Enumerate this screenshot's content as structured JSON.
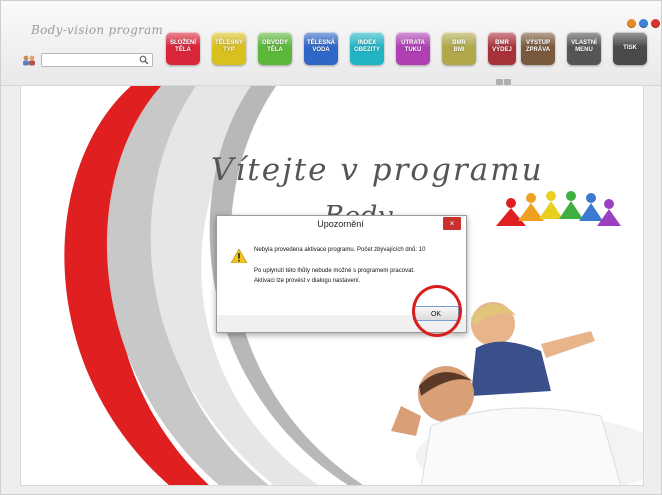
{
  "app": {
    "brand": "Body-vision program"
  },
  "search": {
    "placeholder": ""
  },
  "toolbar": {
    "buttons": [
      {
        "label": "SLOŽENÍ\nTĚLA",
        "color": "#d9263a",
        "icon": "body-composition-icon"
      },
      {
        "label": "TĚLESNÝ\nTYP",
        "color": "#d8c01e",
        "icon": "body-type-icon"
      },
      {
        "label": "OBVODY\nTĚLA",
        "color": "#5cb83a",
        "icon": "body-circumference-icon"
      },
      {
        "label": "TĚLESNÁ\nVODA",
        "color": "#2f67c8",
        "icon": "body-water-icon"
      },
      {
        "label": "INDEX\nOBEZITY",
        "color": "#21b5c4",
        "icon": "obesity-index-icon"
      },
      {
        "label": "ÚTRATA\nTUKU",
        "color": "#b03fb4",
        "icon": "fat-burn-icon"
      },
      {
        "label": "BMR\nBMI",
        "color": "#b0a84a",
        "icon": "bmr-bmi-icon"
      },
      {
        "label": "BMR\nVÝDEJ",
        "color": "#a8323a",
        "icon": "bmr-expense-icon"
      },
      {
        "label": "VÝSTUP\nZPRÁVA",
        "color": "#7a5a3c",
        "icon": "report-icon"
      },
      {
        "label": "VLASTNÍ\nMENU",
        "color": "#555555",
        "icon": "custom-menu-icon"
      },
      {
        "label": "TISK",
        "color": "#4a4a4a",
        "icon": "print-icon"
      }
    ]
  },
  "welcome": {
    "line1": "Vítejte v programu",
    "line2": "Body"
  },
  "dialog": {
    "title": "Upozornění",
    "close": "×",
    "line1": "Nebyla provedena aktivace programu. Počet zbývajících dnů: 10",
    "line2": "Po uplynutí této lhůty nebude možné s programem pracovat.",
    "line3": "Aktivaci lze provést v dialogu nastavení.",
    "ok": "OK"
  },
  "colors": {
    "accent_red": "#d81e1e",
    "swoosh_red": "#e02020"
  }
}
